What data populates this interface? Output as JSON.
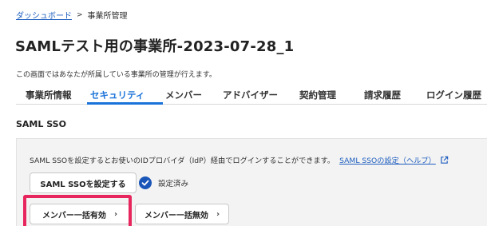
{
  "breadcrumb": {
    "dashboard_label": "ダッシュボード",
    "separator": ">",
    "current_label": "事業所管理"
  },
  "page": {
    "title": "SAMLテスト用の事業所-2023-07-28_1",
    "description": "この画面ではあなたが所属している事業所の管理が行えます。"
  },
  "tabs": [
    {
      "label": "事業所情報",
      "active": false
    },
    {
      "label": "セキュリティ",
      "active": true
    },
    {
      "label": "メンバー",
      "active": false
    },
    {
      "label": "アドバイザー",
      "active": false
    },
    {
      "label": "契約管理",
      "active": false
    },
    {
      "label": "請求履歴",
      "active": false
    },
    {
      "label": "ログイン履歴",
      "active": false
    }
  ],
  "saml": {
    "section_title": "SAML SSO",
    "description": "SAML SSOを設定するとお使いのIDプロバイダ（IdP）経由でログインすることができます。",
    "help_link": "SAML SSOの設定（ヘルプ）",
    "configure_button": "SAML SSOを設定する",
    "status_text": "設定済み",
    "bulk_enable_button": "メンバー一括有効",
    "bulk_disable_button": "メンバー一括無効"
  },
  "colors": {
    "accent": "#1a73d9",
    "link": "#1f5fbf",
    "highlight": "#e8265e",
    "panel_bg": "#f3f3f3"
  },
  "icons": {
    "external": "external-link-icon",
    "status": "check-circle-icon",
    "chevron": "chevron-right-icon"
  }
}
